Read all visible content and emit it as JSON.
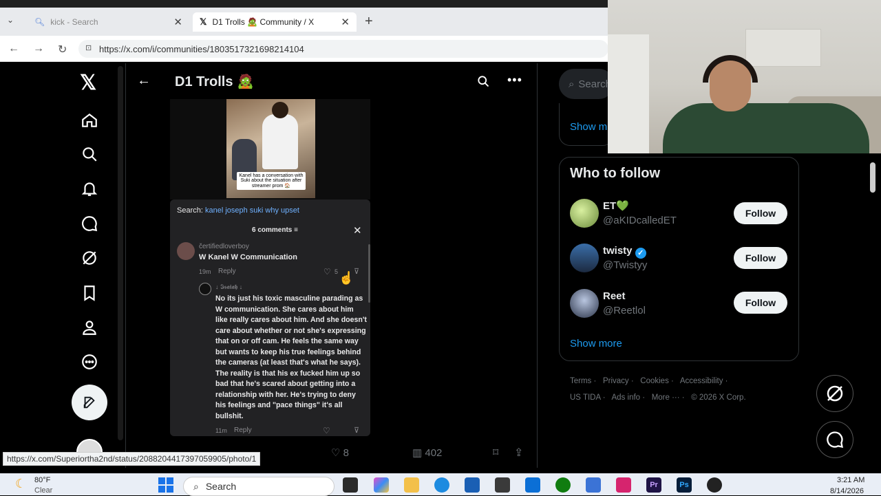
{
  "browser": {
    "tabs": [
      {
        "label": "kick - Search"
      },
      {
        "label": "D1 Trolls 🧟 Community / X"
      }
    ],
    "url": "https://x.com/i/communities/1803517321698214104",
    "status_url": "https://x.com/Superiortha2nd/status/2088204417397059905/photo/1"
  },
  "header": {
    "title": "D1 Trolls 🧟"
  },
  "search_box": {
    "placeholder": "Search"
  },
  "post": {
    "image_caption": "Kanel has a conversation with Suki about the situation after streamer prom 🏠",
    "likes": "8",
    "views": "402"
  },
  "tiktok": {
    "search_label": "Search:",
    "search_query": "kanel joseph suki why upset",
    "comments_count": "6 comments",
    "comment1": {
      "user": "čertifiedloverboy",
      "text": "W Kanel W Communication",
      "time": "19m",
      "reply": "Reply",
      "likes": "5"
    },
    "comment2": {
      "user": "↓ 𝕴𝖘𝖆𝖎𝖆𝖍 ↓",
      "text": "No its just his toxic masculine parading as W communication. She cares about him like really cares about him. And she doesn't care about whether or not she's expressing that on or off cam. He feels the same way but wants to keep his true feelings behind the cameras (at least that's what he says). The reality is that his ex fucked him up so bad that he's scared about getting into a relationship with her. He's trying to deny his feelings and \"pace things\" it's all bullshit.",
      "time": "11m",
      "reply": "Reply"
    }
  },
  "sidebar_right": {
    "show_more_top": "Show m",
    "who_to_follow": "Who to follow",
    "users": [
      {
        "name": "ET💚",
        "handle": "@aKIDcalledET",
        "follow": "Follow"
      },
      {
        "name": "twisty",
        "handle": "@Twistyy",
        "follow": "Follow"
      },
      {
        "name": "Reet",
        "handle": "@Reetlol",
        "follow": "Follow"
      }
    ],
    "show_more": "Show more",
    "footer": {
      "terms": "Terms",
      "privacy": "Privacy",
      "cookies": "Cookies",
      "accessibility": "Accessibility",
      "ustida": "US TIDA",
      "ads": "Ads info",
      "more": "More ···",
      "copyright": "© 2026 X Corp."
    }
  },
  "taskbar": {
    "weather_temp": "80°F",
    "weather_desc": "Clear",
    "search": "Search",
    "time": "3:21 AM",
    "date": "8/14/2026"
  },
  "colors": {
    "accent": "#1d9bf0",
    "x_bg": "#000000",
    "panel": "#222224"
  }
}
